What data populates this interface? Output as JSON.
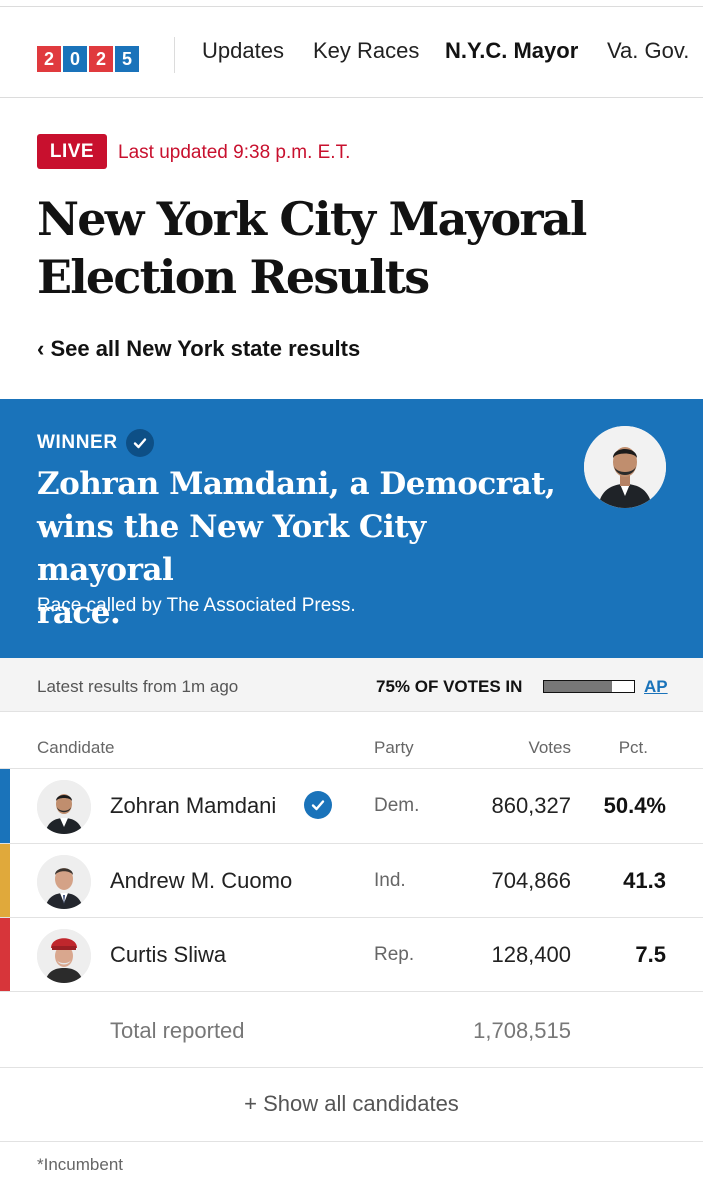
{
  "nav": {
    "logo_digits": [
      "2",
      "0",
      "2",
      "5"
    ],
    "logo_colors": [
      "#e03a3e",
      "#1a73ba",
      "#e03a3e",
      "#1a73ba"
    ],
    "items": [
      "Updates",
      "Key Races",
      "N.Y.C. Mayor",
      "Va. Gov."
    ],
    "active": "N.Y.C. Mayor"
  },
  "header": {
    "live_label": "LIVE",
    "last_updated": "Last updated 9:38 p.m. E.T.",
    "title_line1": "New York City Mayoral",
    "title_line2": "Election Results",
    "see_all": "‹ See all New York state results"
  },
  "banner": {
    "winner_label": "WINNER",
    "headline_line1": "Zohran Mamdani, a Democrat,",
    "headline_line2": "wins the New York City mayoral",
    "headline_line3": "race.",
    "subtext": "Race called by The Associated Press.",
    "color": "#1a73ba"
  },
  "results_bar": {
    "latest": "Latest results from 1m ago",
    "votes_in_label": "75% OF VOTES IN",
    "votes_in_fraction": 0.75,
    "source": "AP"
  },
  "table": {
    "headers": {
      "candidate": "Candidate",
      "party": "Party",
      "votes": "Votes",
      "pct": "Pct."
    },
    "rows": [
      {
        "name": "Zohran Mamdani",
        "party": "Dem.",
        "votes": "860,327",
        "pct": "50.4%",
        "winner": true,
        "color": "#1a73ba"
      },
      {
        "name": "Andrew M. Cuomo",
        "party": "Ind.",
        "votes": "704,866",
        "pct": "41.3",
        "winner": false,
        "color": "#e0a93b"
      },
      {
        "name": "Curtis Sliwa",
        "party": "Rep.",
        "votes": "128,400",
        "pct": "7.5",
        "winner": false,
        "color": "#d7353a"
      }
    ],
    "total_label": "Total reported",
    "total_votes": "1,708,515"
  },
  "show_all": "+ Show all candidates",
  "footnote": "*Incumbent"
}
